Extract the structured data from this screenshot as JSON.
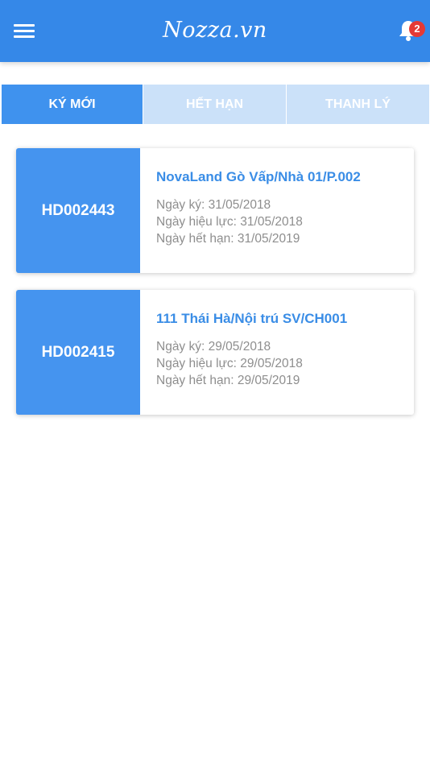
{
  "header": {
    "logo": "Nozza.vn",
    "notification_count": "2",
    "accent_color": "#3588e8",
    "icons": [
      "hamburger-menu-icon",
      "bell-icon"
    ]
  },
  "tabs": [
    {
      "label": "KÝ MỚI",
      "active": true
    },
    {
      "label": "HẾT HẠN",
      "active": false
    },
    {
      "label": "THANH LÝ",
      "active": false
    }
  ],
  "contracts": [
    {
      "code": "HD002443",
      "title": "NovaLand Gò Vấp/Nhà 01/P.002",
      "sign_date": "Ngày ký: 31/05/2018",
      "effective_date": "Ngày hiệu lực: 31/05/2018",
      "expiry_date": "Ngày hết hạn: 31/05/2019"
    },
    {
      "code": "HD002415",
      "title": "111 Thái Hà/Nội trú SV/CH001",
      "sign_date": "Ngày ký: 29/05/2018",
      "effective_date": "Ngày hiệu lực: 29/05/2018",
      "expiry_date": "Ngày hết hạn: 29/05/2019"
    }
  ]
}
